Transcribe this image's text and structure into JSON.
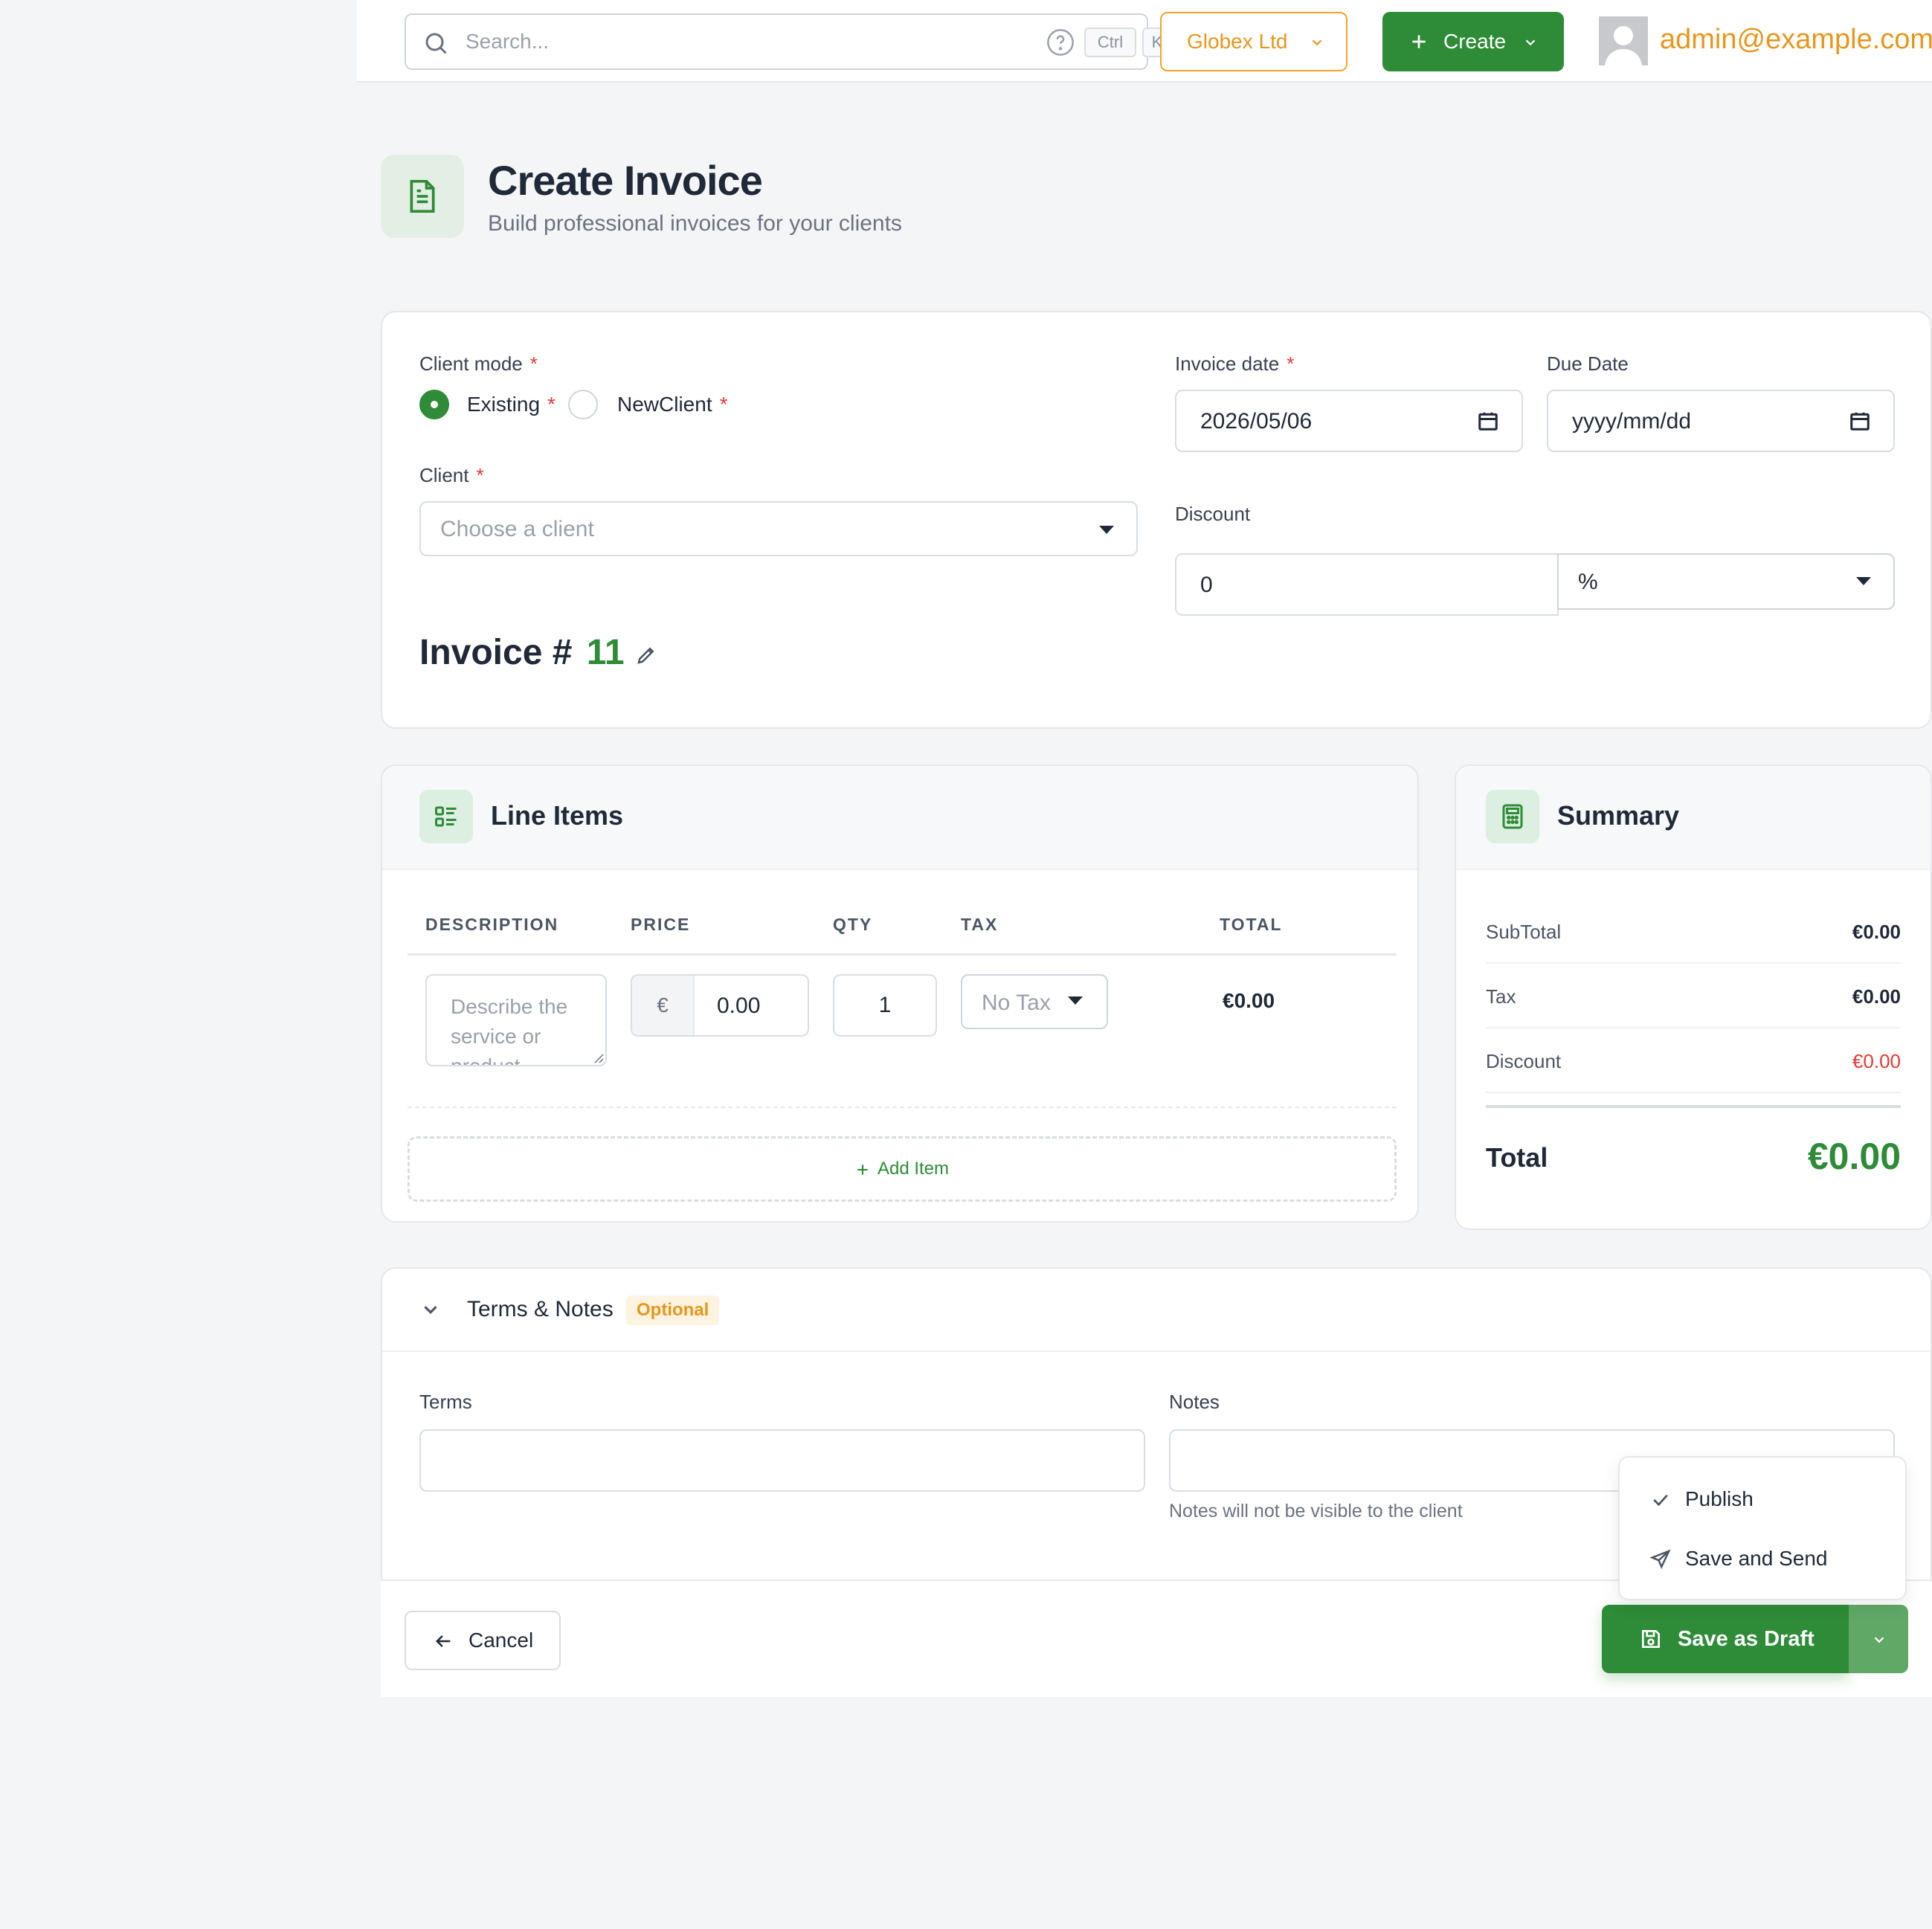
{
  "topbar": {
    "search_placeholder": "Search...",
    "shortcut_keys": [
      "Ctrl",
      "K"
    ],
    "organization": "Globex Ltd",
    "create_label": "Create",
    "user_email": "admin@example.com"
  },
  "page": {
    "title": "Create Invoice",
    "subtitle": "Build professional invoices for your clients"
  },
  "invoice_form": {
    "client_mode_label": "Client mode",
    "client_mode_options": [
      {
        "label": "Existing",
        "selected": true
      },
      {
        "label": "NewClient",
        "selected": false
      }
    ],
    "client_label": "Client",
    "client_placeholder": "Choose a client",
    "invoice_date_label": "Invoice date",
    "invoice_date_value": "2026/05/06",
    "due_date_label": "Due Date",
    "due_date_placeholder": "yyyy/mm/dd",
    "discount_label": "Discount",
    "discount_value": "0",
    "discount_type": "%",
    "invoice_number_label": "Invoice #",
    "invoice_number": "11"
  },
  "line_items": {
    "title": "Line Items",
    "columns": [
      "DESCRIPTION",
      "PRICE",
      "QTY",
      "TAX",
      "TOTAL"
    ],
    "rows": [
      {
        "description_placeholder": "Describe the service or product",
        "currency_symbol": "€",
        "price": "0.00",
        "qty": "1",
        "tax": "No Tax",
        "total": "€0.00"
      }
    ],
    "add_item_label": "Add Item"
  },
  "summary": {
    "title": "Summary",
    "rows": [
      {
        "label": "SubTotal",
        "value": "€0.00"
      },
      {
        "label": "Tax",
        "value": "€0.00"
      },
      {
        "label": "Discount",
        "value": "€0.00"
      }
    ],
    "total_label": "Total",
    "total_value": "€0.00"
  },
  "terms_notes": {
    "title": "Terms & Notes",
    "badge": "Optional",
    "terms_label": "Terms",
    "notes_label": "Notes",
    "notes_hint": "Notes will not be visible to the client"
  },
  "actions": {
    "cancel_label": "Cancel",
    "save_label": "Save as Draft",
    "menu_items": [
      "Publish",
      "Save and Send"
    ]
  },
  "colors": {
    "accent_green": "#2e8b37",
    "accent_orange": "#e8961c",
    "danger_red": "#e53935"
  }
}
